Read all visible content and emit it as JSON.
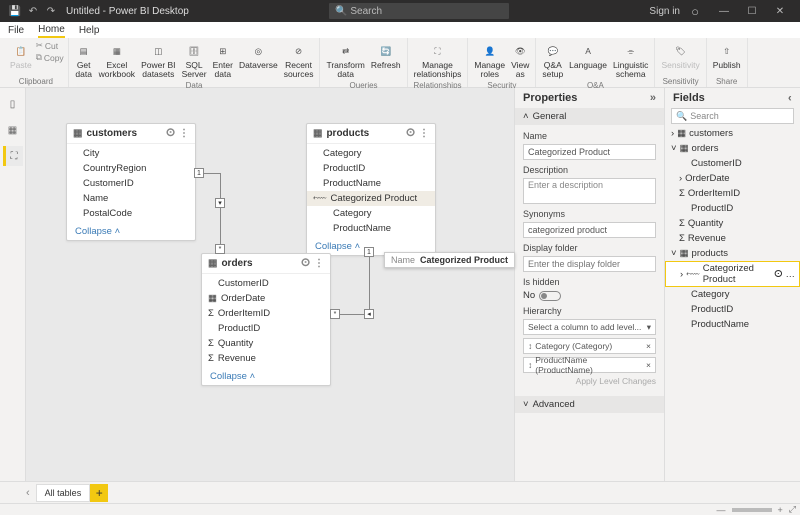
{
  "titlebar": {
    "title": "Untitled - Power BI Desktop",
    "search_placeholder": "Search",
    "signin": "Sign in"
  },
  "menu": {
    "file": "File",
    "home": "Home",
    "help": "Help"
  },
  "ribbon": {
    "paste": "Paste",
    "cut": "Cut",
    "copy": "Copy",
    "getdata": "Get\ndata",
    "excel": "Excel\nworkbook",
    "pbi": "Power BI\ndatasets",
    "sql": "SQL\nServer",
    "enter": "Enter\ndata",
    "dataverse": "Dataverse",
    "recent": "Recent\nsources",
    "transform": "Transform\ndata",
    "refresh": "Refresh",
    "managerel": "Manage\nrelationships",
    "manageroles": "Manage\nroles",
    "viewas": "View\nas",
    "qna": "Q&A\nsetup",
    "language": "Language",
    "ling": "Linguistic\nschema",
    "sens": "Sensitivity",
    "publish": "Publish",
    "g_clipboard": "Clipboard",
    "g_data": "Data",
    "g_queries": "Queries",
    "g_rel": "Relationships",
    "g_sec": "Security",
    "g_qna": "Q&A",
    "g_sens": "Sensitivity",
    "g_share": "Share"
  },
  "tables": {
    "customers": {
      "name": "customers",
      "fields": [
        "City",
        "CountryRegion",
        "CustomerID",
        "Name",
        "PostalCode"
      ],
      "collapse": "Collapse"
    },
    "products": {
      "name": "products",
      "fields": [
        "Category",
        "ProductID",
        "ProductName"
      ],
      "hier": "Categorized Product",
      "hfields": [
        "Category",
        "ProductName"
      ],
      "collapse": "Collapse"
    },
    "orders": {
      "name": "orders",
      "fields": [
        {
          "n": "CustomerID",
          "ic": ""
        },
        {
          "n": "OrderDate",
          "ic": "cal"
        },
        {
          "n": "OrderItemID",
          "ic": "sum"
        },
        {
          "n": "ProductID",
          "ic": ""
        },
        {
          "n": "Quantity",
          "ic": "sum"
        },
        {
          "n": "Revenue",
          "ic": "sum"
        }
      ],
      "collapse": "Collapse"
    }
  },
  "rel": {
    "one": "1",
    "many": "*"
  },
  "properties": {
    "title": "Properties",
    "general": "General",
    "advanced": "Advanced",
    "name_lbl": "Name",
    "name_val": "Categorized Product",
    "desc_lbl": "Description",
    "desc_ph": "Enter a description",
    "syn_lbl": "Synonyms",
    "syn_val": "categorized product",
    "dispf_lbl": "Display folder",
    "dispf_ph": "Enter the display folder",
    "hidden_lbl": "Is hidden",
    "hidden_no": "No",
    "hier_lbl": "Hierarchy",
    "hier_ph": "Select a column to add level...",
    "lvl1": "Category (Category)",
    "lvl2": "ProductName (ProductName)",
    "apply": "Apply Level Changes"
  },
  "tooltip": {
    "label": "Name",
    "val": "Categorized Product"
  },
  "fields": {
    "title": "Fields",
    "search": "Search",
    "t1": "customers",
    "t2": "orders",
    "t2f": [
      "CustomerID",
      "OrderDate",
      "OrderItemID",
      "ProductID",
      "Quantity",
      "Revenue"
    ],
    "t3": "products",
    "t3h": "Categorized Product",
    "t3hf": [
      "Category",
      "ProductID",
      "ProductName"
    ]
  },
  "tabs": {
    "all": "All tables"
  },
  "icons": {
    "undo": "↶",
    "redo": "↷",
    "save": "💾",
    "caret": "▾",
    "search": "🔍",
    "min": "—",
    "max": "☐",
    "close": "✕",
    "eye": "👁",
    "more": "⋮",
    "arrow_up": "˄",
    "arrow_dn": "˅",
    "expand": "»",
    "chev_r": "›",
    "chev_d": "˅",
    "tbl": "▦",
    "cal": "📅",
    "sum": "Σ",
    "hier": "⬳",
    "x": "×",
    "dots": "…",
    "updn": "↕",
    "plus": "+",
    "circle": "○",
    "arrow45": "◿",
    "fit": "⤢",
    "arrowr": "▸"
  }
}
